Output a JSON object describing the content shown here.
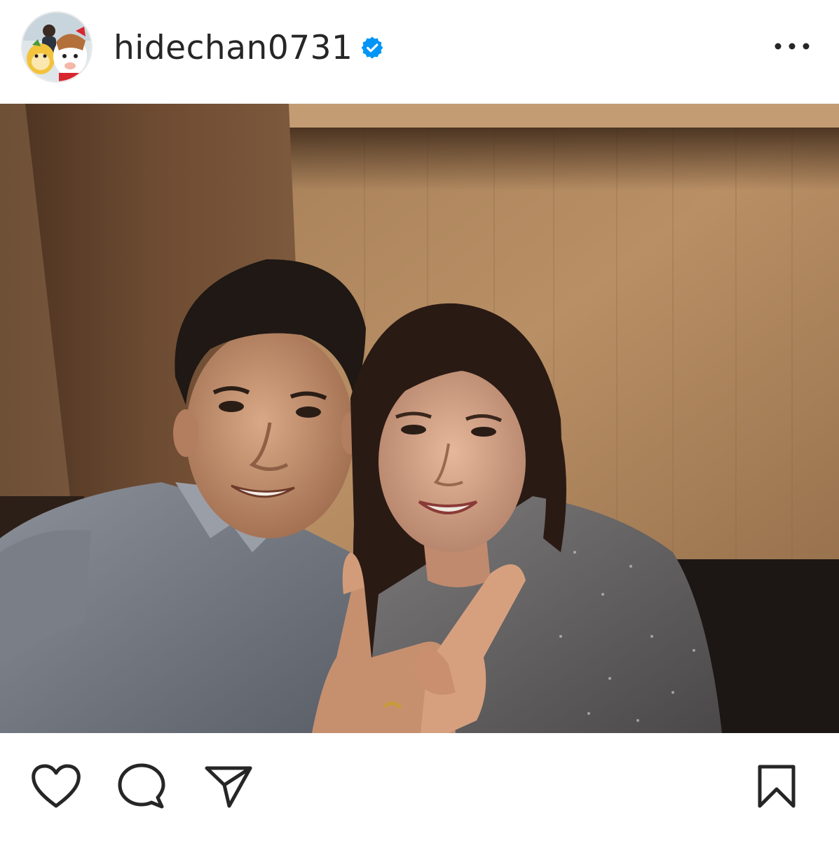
{
  "post": {
    "username": "hidechan0731",
    "verified": true
  },
  "icons": {
    "avatar": "profile-avatar",
    "verified": "verified-badge-icon",
    "more": "more-options-icon",
    "like": "heart-icon",
    "comment": "comment-bubble-icon",
    "share": "paper-plane-icon",
    "save": "bookmark-icon"
  },
  "colors": {
    "text": "#262626",
    "verified_blue": "#0095f6",
    "icon_stroke": "#262626",
    "background": "#ffffff"
  }
}
